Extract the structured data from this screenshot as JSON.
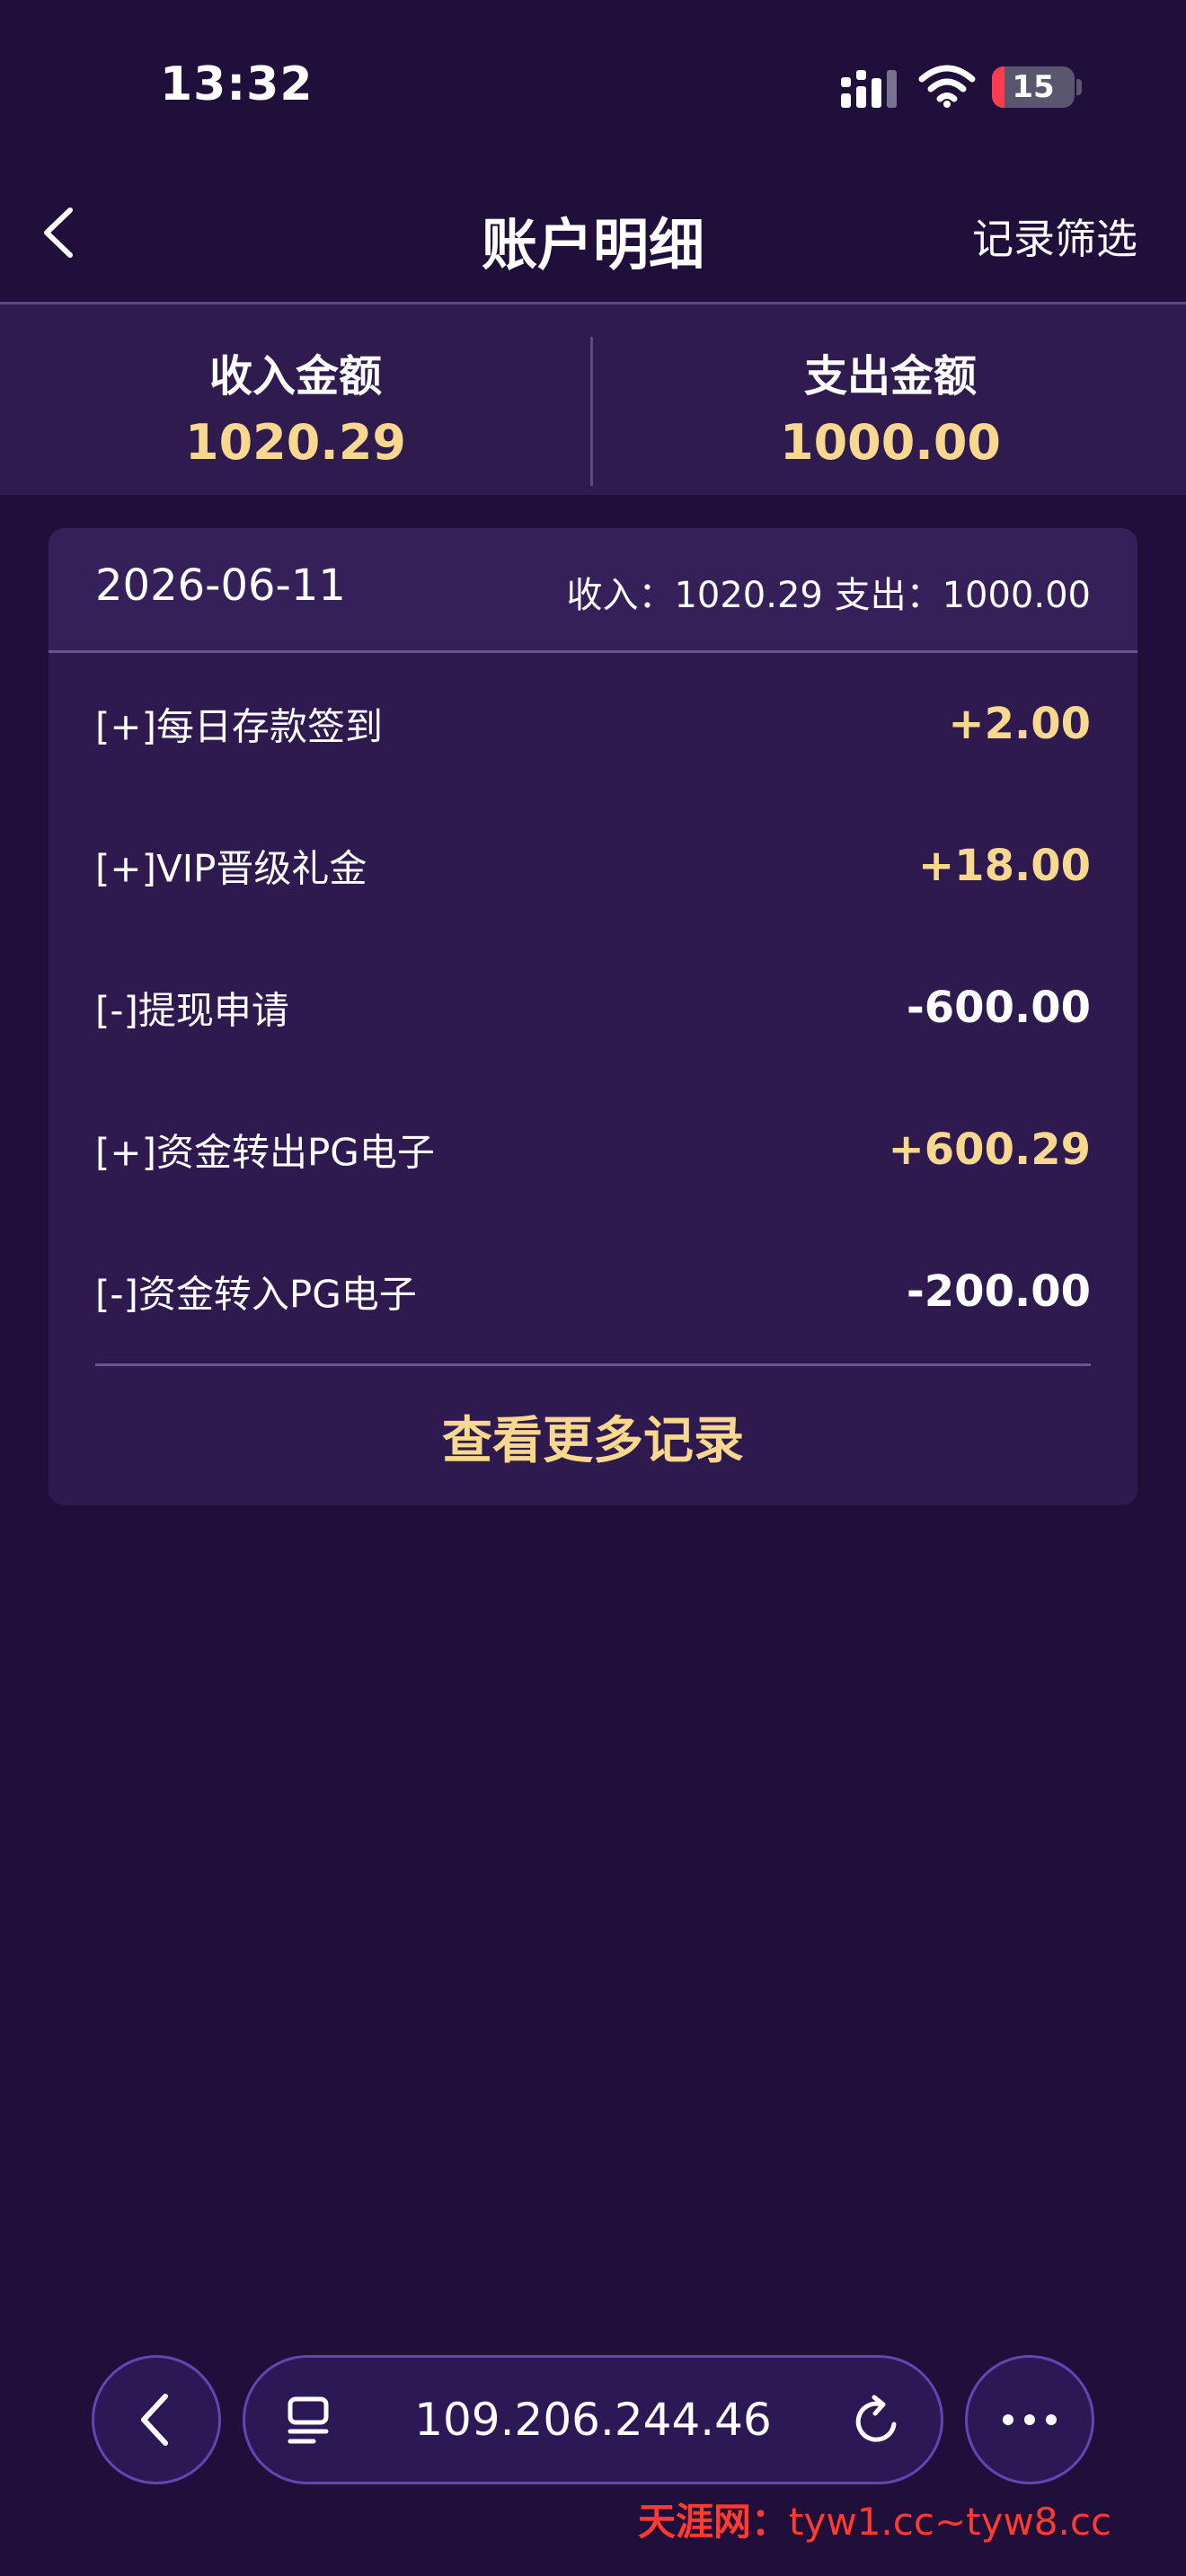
{
  "status_bar": {
    "time": "13:32",
    "battery_level": "15",
    "icons": [
      "cellular-signal-icon",
      "wifi-icon",
      "battery-icon"
    ]
  },
  "nav": {
    "back_icon": "chevron-left-icon",
    "title": "账户明细",
    "filter_label": "记录筛选"
  },
  "summary": {
    "income_label": "收入金额",
    "income_value": "1020.29",
    "expense_label": "支出金额",
    "expense_value": "1000.00"
  },
  "card": {
    "date": "2026-06-11",
    "totals": "收入：1020.29   支出：1000.00",
    "rows": [
      {
        "label": "[+]每日存款签到",
        "amount": "+2.00",
        "kind": "pos"
      },
      {
        "label": "[+]VIP晋级礼金",
        "amount": "+18.00",
        "kind": "pos"
      },
      {
        "label": "[-]提现申请",
        "amount": "-600.00",
        "kind": "neg"
      },
      {
        "label": "[+]资金转出PG电子",
        "amount": "+600.29",
        "kind": "pos"
      },
      {
        "label": "[-]资金转入PG电子",
        "amount": "-200.00",
        "kind": "neg"
      }
    ],
    "more_label": "查看更多记录"
  },
  "toolbar": {
    "url": "109.206.244.46",
    "icons": [
      "back-icon",
      "tabs-icon",
      "reload-icon",
      "more-icon"
    ]
  },
  "watermark": {
    "brand": "天涯网：",
    "urls": "tyw1.cc~tyw8.cc"
  },
  "colors": {
    "background": "#200f3b",
    "panel": "#301b4f",
    "accent_gold": "#f7d88e",
    "toolbar_border": "#6346b2",
    "battery_low": "#ff3b4e",
    "watermark_red": "#ff3b30"
  }
}
